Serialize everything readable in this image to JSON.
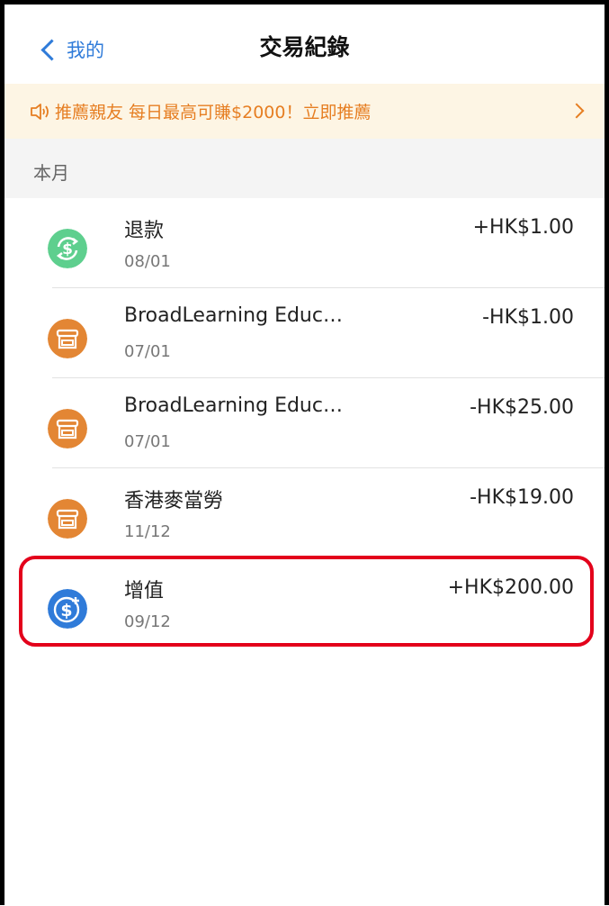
{
  "nav": {
    "back_label": "我的",
    "title": "交易紀錄"
  },
  "banner": {
    "text": "推薦親友 每日最高可賺$2000！立即推薦"
  },
  "section": {
    "label": "本月"
  },
  "transactions": [
    {
      "name": "退款",
      "date": "08/01",
      "amount": "+HK$1.00",
      "icon": "refund-dollar-icon",
      "icon_color": "#5ecf8e"
    },
    {
      "name": "BroadLearning Educ…",
      "date": "07/01",
      "amount": "-HK$1.00",
      "icon": "merchant-store-icon",
      "icon_color": "#e38634"
    },
    {
      "name": "BroadLearning Educ…",
      "date": "07/01",
      "amount": "-HK$25.00",
      "icon": "merchant-store-icon",
      "icon_color": "#e38634"
    },
    {
      "name": "香港麥當勞",
      "date": "11/12",
      "amount": "-HK$19.00",
      "icon": "merchant-store-icon",
      "icon_color": "#e38634"
    },
    {
      "name": "增值",
      "date": "09/12",
      "amount": "+HK$200.00",
      "icon": "topup-dollar-icon",
      "icon_color": "#2f7bd9"
    }
  ],
  "colors": {
    "accent_blue": "#2f7bd9",
    "banner_orange": "#e67e22",
    "highlight_red": "#e3001b"
  }
}
